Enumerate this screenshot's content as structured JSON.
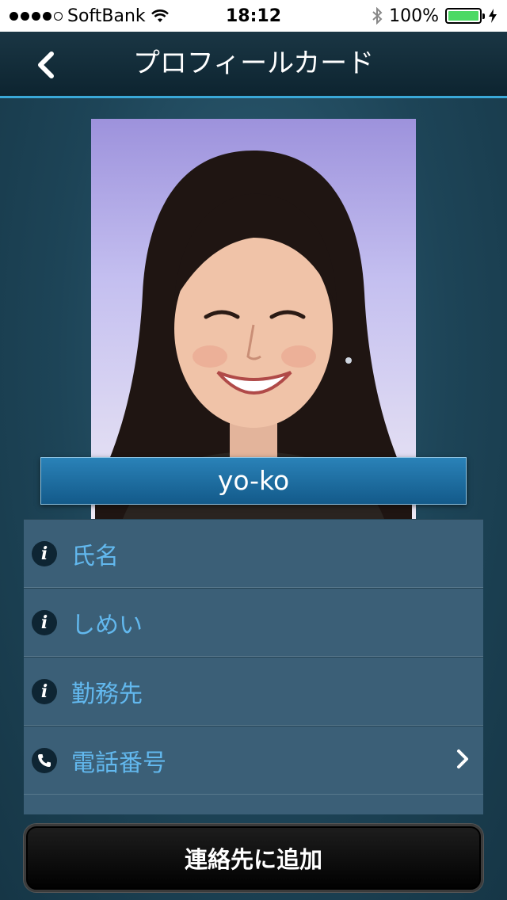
{
  "status_bar": {
    "carrier": "SoftBank",
    "time": "18:12",
    "battery": "100%",
    "signal_bars": 4,
    "signal_total": 5
  },
  "nav": {
    "title": "プロフィールカード",
    "back_icon": "chevron-left-icon"
  },
  "profile": {
    "name": "yo-ko"
  },
  "info_rows": [
    {
      "icon": "info-icon",
      "label": "氏名"
    },
    {
      "icon": "info-icon",
      "label": "しめい"
    },
    {
      "icon": "info-icon",
      "label": "勤務先"
    },
    {
      "icon": "phone-icon",
      "label": "電話番号",
      "chevron": true
    }
  ],
  "actions": {
    "add_contact": "連絡先に追加"
  },
  "colors": {
    "accent": "#3aa8d8",
    "label": "#62b8ee",
    "list_bg": "#3b5f77",
    "battery": "#4cd964"
  }
}
